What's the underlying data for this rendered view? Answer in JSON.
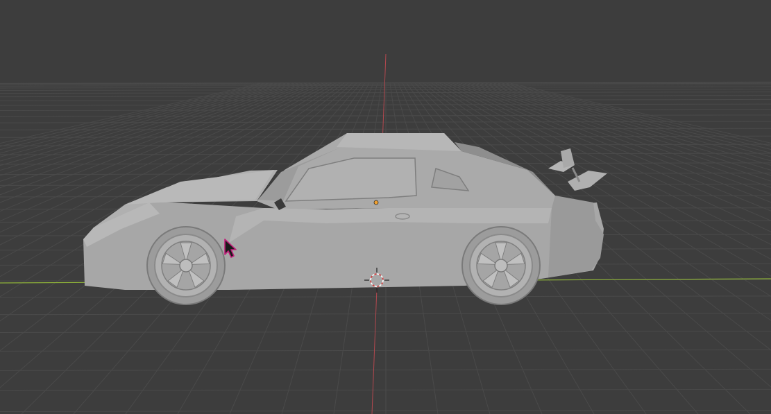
{
  "viewport": {
    "background_color": "#3d3d3d",
    "grid_color": "#4a4a4a",
    "x_axis_color": "#8fb33a",
    "y_axis_color": "#b3484f",
    "car_body_color": "#a9a9a9",
    "car_shadow_color": "#8a8a8a",
    "car_highlight_color": "#bdbdbd",
    "origin_dot_color": "#f0a030",
    "cursor_color": "#c0207a",
    "icons": [
      "3d-cursor-icon",
      "mouse-pointer-icon",
      "object-origin-icon"
    ]
  }
}
